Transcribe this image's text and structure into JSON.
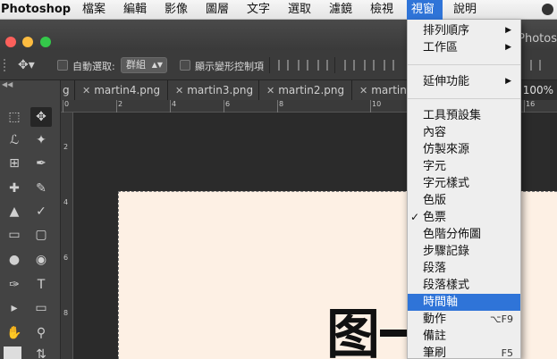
{
  "menubar": {
    "app": "Photoshop",
    "items": [
      "檔案",
      "編輯",
      "影像",
      "圖層",
      "文字",
      "選取",
      "濾鏡",
      "檢視",
      "視窗",
      "說明"
    ],
    "active_index": 8
  },
  "titlebar": {
    "title": "Photos"
  },
  "options_bar": {
    "auto_select_label": "自動選取:",
    "auto_select_value": "群組",
    "show_transform_label": "顯示變形控制項"
  },
  "tabs": {
    "items": [
      "g",
      "martin4.png",
      "martin3.png",
      "martin2.png",
      "martin"
    ],
    "zoom": "100%"
  },
  "ruler": {
    "top_labels": [
      "0",
      "2",
      "4",
      "6",
      "8",
      "10",
      "12",
      "16"
    ],
    "left_labels": [
      "2",
      "4",
      "6",
      "8"
    ]
  },
  "canvas": {
    "text": "图"
  },
  "window_menu": {
    "top_items": [
      {
        "label": "排列順序",
        "submenu": true
      },
      {
        "label": "工作區",
        "submenu": true
      }
    ],
    "extensions": {
      "label": "延伸功能",
      "submenu": true
    },
    "panels": [
      {
        "label": "工具預設集"
      },
      {
        "label": "內容"
      },
      {
        "label": "仿製來源"
      },
      {
        "label": "字元"
      },
      {
        "label": "字元樣式"
      },
      {
        "label": "色版"
      },
      {
        "label": "色票",
        "checked": true
      },
      {
        "label": "色階分佈圖"
      },
      {
        "label": "步驟記錄"
      },
      {
        "label": "段落"
      },
      {
        "label": "段落樣式"
      },
      {
        "label": "時間軸",
        "highlighted": true
      },
      {
        "label": "動作",
        "shortcut": "⌥F9"
      },
      {
        "label": "備註"
      },
      {
        "label": "筆刷",
        "shortcut": "F5"
      }
    ]
  },
  "colors": {
    "menu_highlight": "#2f74d8",
    "canvas_bg": "#fdf0e4",
    "close": "#fc605b",
    "minimize": "#fdbc40",
    "maximize": "#34c84a"
  }
}
